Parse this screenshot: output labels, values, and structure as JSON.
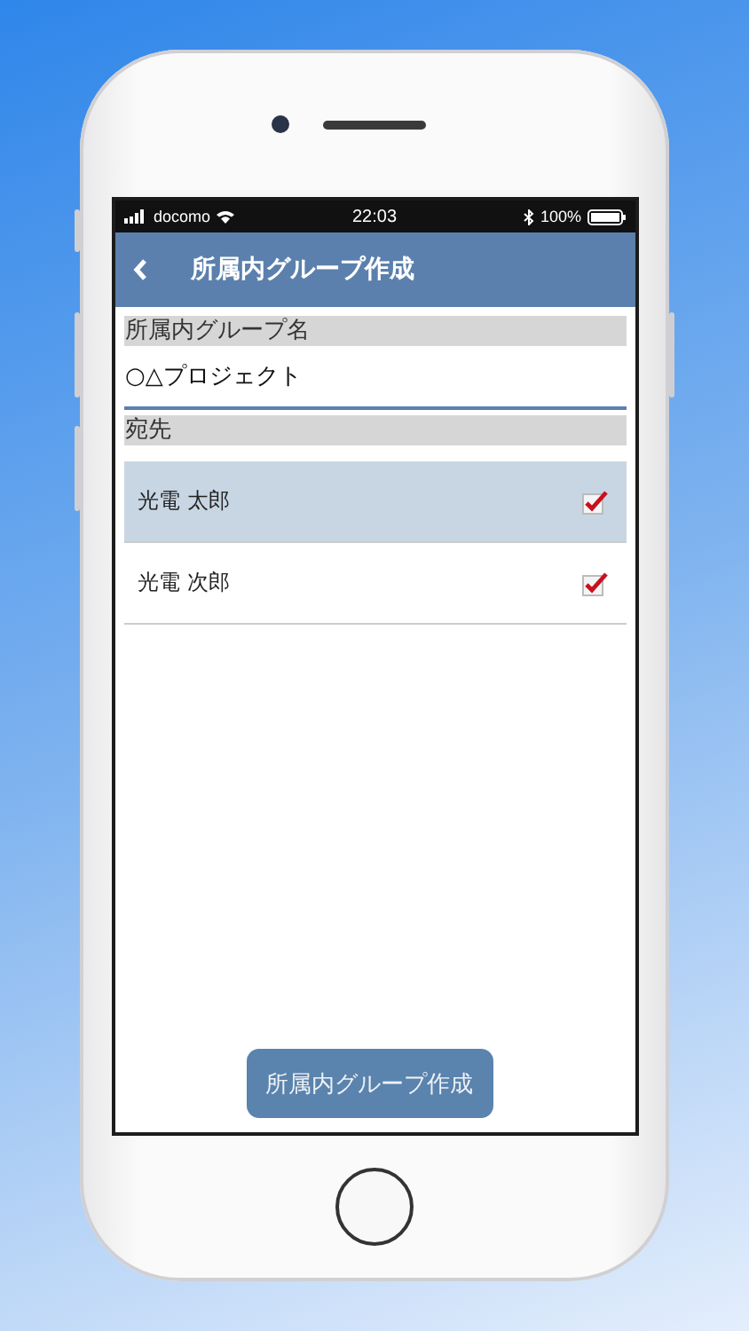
{
  "status_bar": {
    "carrier": "docomo",
    "time": "22:03",
    "battery": "100%"
  },
  "header": {
    "title": "所属内グループ作成"
  },
  "group_name": {
    "label": "所属内グループ名",
    "value": "○△プロジェクト"
  },
  "recipients": {
    "label": "宛先",
    "rows": [
      {
        "name": "光電 太郎",
        "selected": true,
        "checked": true
      },
      {
        "name": "光電 次郎",
        "selected": false,
        "checked": true
      }
    ]
  },
  "submit_button": "所属内グループ作成"
}
